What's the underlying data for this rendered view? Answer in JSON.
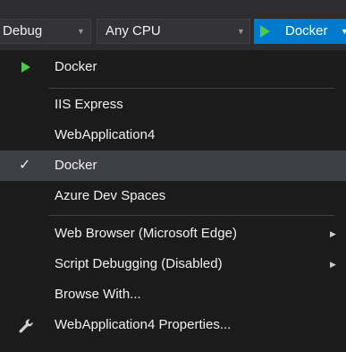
{
  "toolbar": {
    "config": "Debug",
    "platform": "Any CPU",
    "run_target": "Docker",
    "dropdown_glyph": "▼"
  },
  "menu": {
    "items": [
      {
        "label": "Docker",
        "icon": "play-icon"
      },
      {
        "label": "IIS Express"
      },
      {
        "label": "WebApplication4"
      },
      {
        "label": "Docker",
        "icon": "checkmark-icon",
        "checked": true
      },
      {
        "label": "Azure Dev Spaces"
      },
      {
        "label": "Web Browser (Microsoft Edge)",
        "submenu": true
      },
      {
        "label": "Script Debugging (Disabled)",
        "submenu": true
      },
      {
        "label": "Browse With..."
      },
      {
        "label": "WebApplication4 Properties...",
        "icon": "wrench-icon"
      }
    ],
    "check_glyph": "✓",
    "submenu_glyph": "▶"
  },
  "colors": {
    "accent": "#007acc",
    "play": "#4ec94a",
    "background": "#1b1b1c",
    "toolbar": "#2d2d30"
  }
}
